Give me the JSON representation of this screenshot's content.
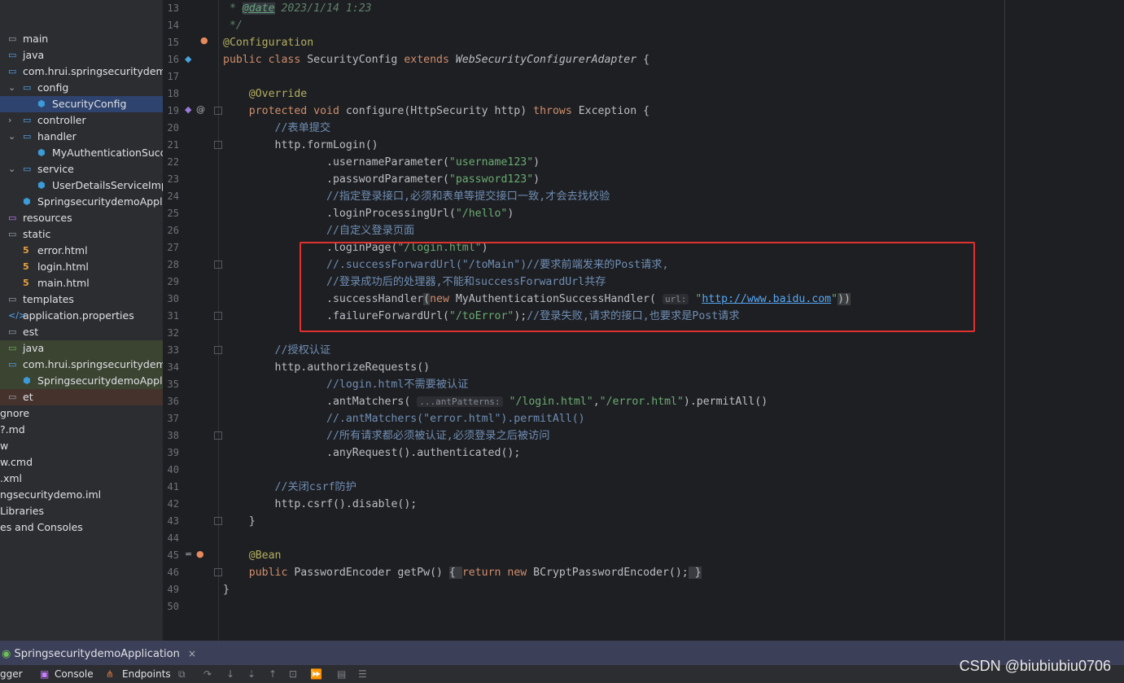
{
  "project_tree": [
    {
      "label": "main",
      "icon": "folder-icon",
      "arrow": ""
    },
    {
      "label": "java",
      "icon": "source-folder-icon",
      "arrow": ""
    },
    {
      "label": "com.hrui.springsecuritydemo",
      "icon": "package-icon",
      "arrow": ""
    },
    {
      "label": "config",
      "icon": "package-icon",
      "arrow": "expanded"
    },
    {
      "label": "SecurityConfig",
      "icon": "class-icon",
      "arrow": "",
      "selected": true
    },
    {
      "label": "controller",
      "icon": "package-icon",
      "arrow": "collapsed"
    },
    {
      "label": "handler",
      "icon": "package-icon",
      "arrow": "expanded"
    },
    {
      "label": "MyAuthenticationSuccessHandler",
      "icon": "class-icon",
      "arrow": ""
    },
    {
      "label": "service",
      "icon": "package-icon",
      "arrow": "expanded"
    },
    {
      "label": "UserDetailsServiceImpl",
      "icon": "class-icon",
      "arrow": ""
    },
    {
      "label": "SpringsecuritydemoApplication",
      "icon": "spring-class-icon",
      "arrow": ""
    },
    {
      "label": "resources",
      "icon": "resources-folder-icon",
      "arrow": ""
    },
    {
      "label": "static",
      "icon": "folder-icon",
      "arrow": ""
    },
    {
      "label": "error.html",
      "icon": "html-file-icon",
      "arrow": ""
    },
    {
      "label": "login.html",
      "icon": "html-file-icon",
      "arrow": ""
    },
    {
      "label": "main.html",
      "icon": "html-file-icon",
      "arrow": ""
    },
    {
      "label": "templates",
      "icon": "folder-icon",
      "arrow": ""
    },
    {
      "label": "application.properties",
      "icon": "properties-file-icon",
      "arrow": ""
    },
    {
      "label": "est",
      "icon": "folder-icon",
      "arrow": ""
    },
    {
      "label": "java",
      "icon": "test-folder-icon",
      "arrow": "",
      "test": true
    },
    {
      "label": "com.hrui.springsecuritydemo",
      "icon": "package-icon",
      "arrow": "",
      "test": true
    },
    {
      "label": "SpringsecuritydemoApplication",
      "icon": "class-icon",
      "arrow": "",
      "test": true
    },
    {
      "label": "et",
      "icon": "folder-icon",
      "arrow": "",
      "excluded": true
    },
    {
      "label": "gnore",
      "icon": "file-icon",
      "arrow": ""
    },
    {
      "label": "?.md",
      "icon": "file-icon",
      "arrow": ""
    },
    {
      "label": "w",
      "icon": "file-icon",
      "arrow": ""
    },
    {
      "label": "w.cmd",
      "icon": "file-icon",
      "arrow": ""
    },
    {
      "label": ".xml",
      "icon": "file-icon",
      "arrow": ""
    },
    {
      "label": "ngsecuritydemo.iml",
      "icon": "file-icon",
      "arrow": ""
    },
    {
      "label": " Libraries",
      "icon": "file-icon",
      "arrow": ""
    },
    {
      "label": "es and Consoles",
      "icon": "file-icon",
      "arrow": ""
    }
  ],
  "line_numbers": [
    "13",
    "14",
    "15",
    "16",
    "17",
    "18",
    "19",
    "20",
    "21",
    "22",
    "23",
    "24",
    "25",
    "26",
    "27",
    "28",
    "29",
    "30",
    "31",
    "32",
    "33",
    "34",
    "35",
    "36",
    "37",
    "38",
    "39",
    "40",
    "41",
    "42",
    "43",
    "44",
    "45",
    "46",
    "49",
    "50"
  ],
  "code": {
    "l13_a": " * ",
    "l13_tag": "@date",
    "l13_b": " 2023/1/14 1:23",
    "l14": " */",
    "l15": "@Configuration",
    "l16_kw": "public class ",
    "l16_cls": "SecurityConfig ",
    "l16_ext": "extends ",
    "l16_sup": "WebSecurityConfigurerAdapter",
    "l16_br": " {",
    "l18": "    @Override",
    "l19_kw": "    protected void ",
    "l19_fn": "configure",
    "l19_a": "(HttpSecurity http) ",
    "l19_th": "throws ",
    "l19_b": "Exception {",
    "l20": "        //表单提交",
    "l21_a": "        http.",
    "l21_fn": "formLogin",
    "l21_b": "()",
    "l22_a": "                .",
    "l22_fn": "usernameParameter",
    "l22_b": "(",
    "l22_s": "\"username123\"",
    "l22_c": ")",
    "l23_a": "                .",
    "l23_fn": "passwordParameter",
    "l23_b": "(",
    "l23_s": "\"password123\"",
    "l23_c": ")",
    "l24": "                //指定登录接口,必须和表单等提交接口一致,才会去找校验",
    "l25_a": "                .",
    "l25_fn": "loginProcessingUrl",
    "l25_b": "(",
    "l25_s": "\"/hello\"",
    "l25_c": ")",
    "l26": "                //自定义登录页面",
    "l27_a": "                .",
    "l27_fn": "loginPage",
    "l27_b": "(",
    "l27_s": "\"/login.html\"",
    "l27_c": ")",
    "l28": "                //.successForwardUrl(\"/toMain\")//要求前端发来的Post请求,",
    "l29": "                //登录成功后的处理器,不能和successForwardUrl共存",
    "l30_a": "                .",
    "l30_fn": "successHandler",
    "l30_p": "(",
    "l30_new": "new ",
    "l30_cls": "MyAuthenticationSuccessHandler",
    "l30_p2": "( ",
    "l30_hint": "url:",
    "l30_q1": " \"",
    "l30_url": "http://www.baidu.com",
    "l30_q2": "\"",
    "l30_end": "))",
    "l31_a": "                .",
    "l31_fn": "failureForwardUrl",
    "l31_b": "(",
    "l31_s": "\"/toError\"",
    "l31_c": ");",
    "l31_cm": "//登录失败,请求的接口,也要求是Post请求",
    "l33": "        //授权认证",
    "l34_a": "        http.",
    "l34_fn": "authorizeRequests",
    "l34_b": "()",
    "l35": "                //login.html不需要被认证",
    "l36_a": "                .",
    "l36_fn": "antMatchers",
    "l36_b": "( ",
    "l36_hint": "...antPatterns:",
    "l36_s1": " \"/login.html\"",
    "l36_c": ",",
    "l36_s2": "\"/error.html\"",
    "l36_d": ").",
    "l36_fn2": "permitAll",
    "l36_e": "()",
    "l37": "                //.antMatchers(\"error.html\").permitAll()",
    "l38": "                //所有请求都必须被认证,必须登录之后被访问",
    "l39_a": "                .",
    "l39_fn": "anyRequest",
    "l39_b": "().",
    "l39_fn2": "authenticated",
    "l39_c": "();",
    "l41": "        //关闭csrf防护",
    "l42_a": "        http.",
    "l42_fn": "csrf",
    "l42_b": "().",
    "l42_fn2": "disable",
    "l42_c": "();",
    "l43": "    }",
    "l45": "    @Bean",
    "l46_kw": "    public ",
    "l46_cls": "PasswordEncoder ",
    "l46_fn": "getPw",
    "l46_a": "() ",
    "l46_f1": "{ ",
    "l46_ret": "return new ",
    "l46_b": "BCryptPasswordEncoder();",
    "l46_f2": " }",
    "l49": "}"
  },
  "run_panel": {
    "tab_label": "SpringsecuritydemoApplication",
    "close": "×"
  },
  "toolbar": {
    "debugger": "gger",
    "console": "Console",
    "endpoints": "Endpoints"
  },
  "watermark": "CSDN @biubiubiu0706",
  "colors": {
    "highlight_box": "#e03131",
    "selection": "#2e436e",
    "run_bar": "#3c3f58"
  }
}
